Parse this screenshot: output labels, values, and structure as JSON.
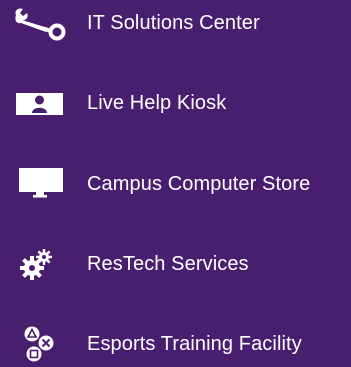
{
  "menu": {
    "items": [
      {
        "label": "IT Solutions Center",
        "icon": "wrench-icon"
      },
      {
        "label": "Live Help Kiosk",
        "icon": "person-badge-icon"
      },
      {
        "label": "Campus Computer Store",
        "icon": "monitor-icon"
      },
      {
        "label": "ResTech Services",
        "icon": "gears-icon"
      },
      {
        "label": "Esports Training Facility",
        "icon": "gamepad-buttons-icon"
      }
    ]
  },
  "colors": {
    "background": "#4a1e6e",
    "text": "#ffffff",
    "icon": "#ffffff"
  }
}
